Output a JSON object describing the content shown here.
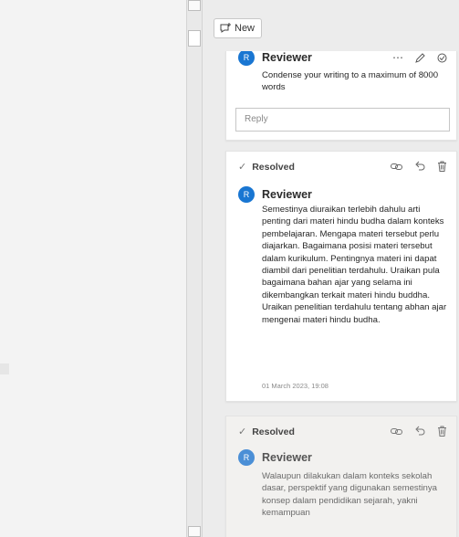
{
  "toolbar": {
    "new_label": "New"
  },
  "comments": [
    {
      "author": "Reviewer",
      "avatar": "R",
      "text": "Condense your writing to a maximum of 8000 words",
      "reply_placeholder": "Reply",
      "actions": [
        "more-icon",
        "edit-icon",
        "resolve-icon"
      ]
    },
    {
      "status": "Resolved",
      "author": "Reviewer",
      "avatar": "R",
      "text": "Semestinya diuraikan terlebih dahulu arti penting dari materi hindu budha dalam konteks pembelajaran. Mengapa materi tersebut perlu diajarkan. Bagaimana posisi materi tersebut dalam kurikulum. Pentingnya materi ini dapat diambil dari penelitian terdahulu. Uraikan pula bagaimana bahan ajar yang selama ini dikembangkan terkait materi hindu buddha. Uraikan penelitian terdahulu tentang abhan ajar mengenai materi hindu budha.",
      "timestamp": "01 March 2023, 19:08",
      "actions": [
        "link-icon",
        "reopen-icon",
        "delete-icon"
      ]
    },
    {
      "status": "Resolved",
      "author": "Reviewer",
      "avatar": "R",
      "text": "Walaupun dilakukan dalam konteks sekolah dasar, perspektif yang digunakan semestinya konsep dalam pendidikan sejarah, yakni kemampuan",
      "actions": [
        "link-icon",
        "reopen-icon",
        "delete-icon"
      ]
    }
  ],
  "colors": {
    "accent": "#1976d2",
    "pane_bg": "#ececec",
    "resolved_bg": "#f2f1ef"
  }
}
